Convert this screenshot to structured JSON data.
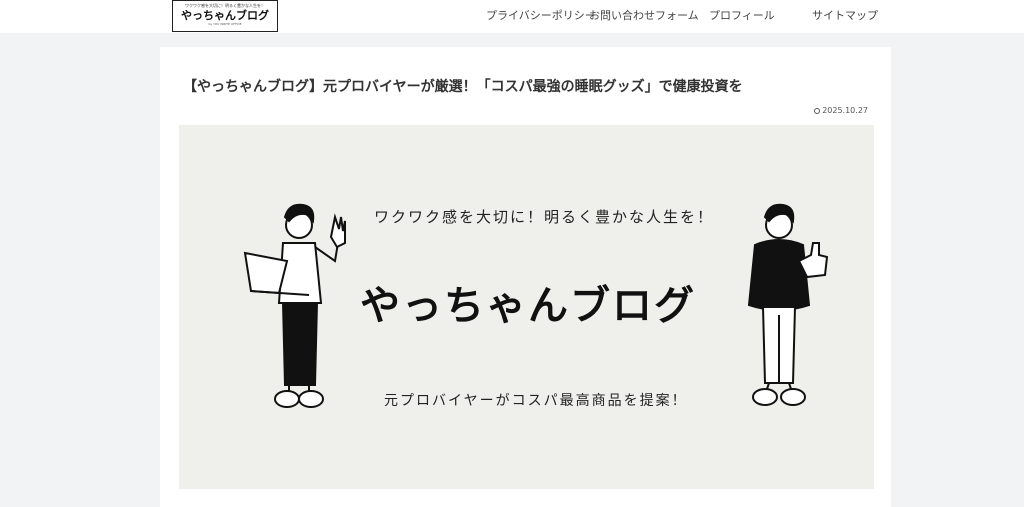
{
  "header": {
    "logo": {
      "tagline": "ワクワク感を大切に！明るく豊かな人生を！",
      "name": "やっちゃんブログ",
      "sub": "by YOU WRITE OFFICE"
    },
    "nav": [
      {
        "label": "プライバシーポリシー"
      },
      {
        "label": "お問い合わせフォーム"
      },
      {
        "label": "プロフィール"
      },
      {
        "label": "サイトマップ"
      }
    ]
  },
  "article": {
    "title": "【やっちゃんブログ】元プロバイヤーが厳選！「コスパ最強の睡眠グッズ」で健康投資を",
    "date": "2025.10.27",
    "date_icon": "clock-icon",
    "hero": {
      "tagline_top": "ワクワク感を大切に！明るく豊かな人生を！",
      "title": "やっちゃんブログ",
      "tagline_bottom": "元プロバイヤーがコスパ最高商品を提案！",
      "background": "#efefec"
    }
  },
  "colors": {
    "page_bg": "#f2f3f4",
    "card_bg": "#ffffff",
    "text": "#333333"
  }
}
